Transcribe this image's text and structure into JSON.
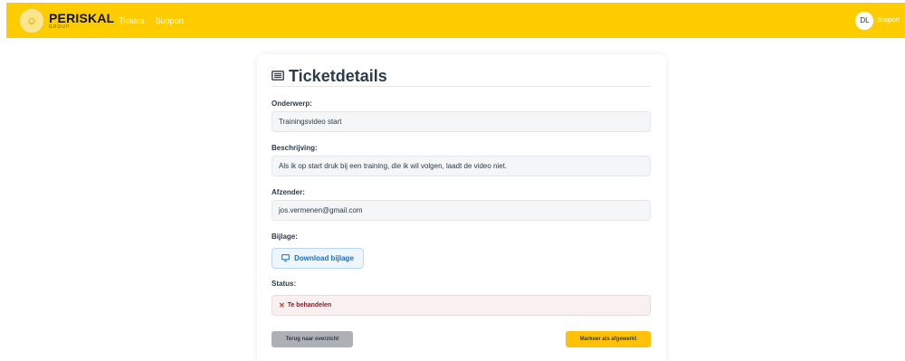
{
  "navbar": {
    "logo_text": "PERISKAL",
    "logo_sub": "GROUP",
    "links": [
      "Tickets",
      "Support"
    ],
    "avatar_initials": "DL",
    "user_label": "Support",
    "color": "#ffcc00"
  },
  "ticket": {
    "title": "Ticketdetails",
    "title_icon": "ticket-icon",
    "subject_label": "Onderwerp:",
    "subject_value": "Trainingsvideo start",
    "description_label": "Beschrijving:",
    "description_value": "Als ik op start druk bij een training, die ik wil volgen, laadt de video niet.",
    "sender_label": "Afzender:",
    "sender_value": "jos.vermenen@gmail.com",
    "attachment_label": "Bijlage:",
    "download_label": "Download bijlage",
    "status_label": "Status:",
    "status_value": "Te behandelen",
    "status_color": "#7a1d24",
    "back_button": "Terug naar overzicht",
    "done_button": "Markeer als afgewerkt",
    "done_button_color": "#ffc107"
  }
}
